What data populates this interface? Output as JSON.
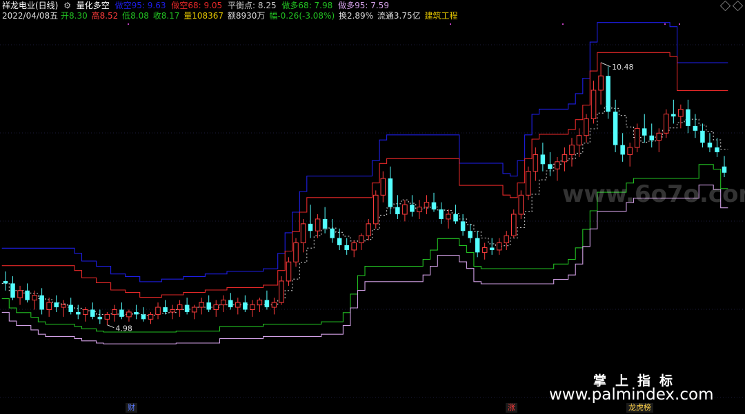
{
  "header": {
    "stock": "祥龙电业(日线)",
    "indicator": "量化多空",
    "lines": [
      {
        "label": "做空95: 9.63",
        "color": "#1e1ee6"
      },
      {
        "label": "做空68: 9.05",
        "color": "#e62828"
      },
      {
        "label": "平衡点: 8.25",
        "color": "#c8c8c8"
      },
      {
        "label": "做多68: 7.98",
        "color": "#22c022"
      },
      {
        "label": "做多95: 7.59",
        "color": "#d2a0e6"
      }
    ]
  },
  "quote": {
    "date": "2022/04/08五",
    "open": "开8.30",
    "high": "高8.52",
    "low": "低8.08",
    "close": "收8.17",
    "volume": "量108367",
    "amount": "额8930万",
    "change": "幅-0.26(-3.08%)",
    "turnover": "换2.89%",
    "float": "流通3.75亿",
    "sector": "建筑工程"
  },
  "chart_data": {
    "type": "candlestick",
    "ylim": [
      3.3,
      11.3
    ],
    "annotations": {
      "max_label": "10.48",
      "min_label": "4.98"
    },
    "series_names": [
      "做空95",
      "做空68",
      "平衡点",
      "做多68",
      "做多95"
    ],
    "candles": [
      [
        5.9,
        6.1,
        5.7,
        5.85
      ],
      [
        5.85,
        6.0,
        5.5,
        5.55
      ],
      [
        5.55,
        5.8,
        5.4,
        5.7
      ],
      [
        5.7,
        5.85,
        5.45,
        5.5
      ],
      [
        5.5,
        5.7,
        5.3,
        5.6
      ],
      [
        5.6,
        5.75,
        5.2,
        5.3
      ],
      [
        5.3,
        5.55,
        5.15,
        5.45
      ],
      [
        5.45,
        5.6,
        5.25,
        5.35
      ],
      [
        5.35,
        5.5,
        5.15,
        5.4
      ],
      [
        5.4,
        5.55,
        5.2,
        5.25
      ],
      [
        5.25,
        5.4,
        5.1,
        5.2
      ],
      [
        5.2,
        5.35,
        5.05,
        5.3
      ],
      [
        5.3,
        5.45,
        5.1,
        5.15
      ],
      [
        5.15,
        5.3,
        5.0,
        5.1
      ],
      [
        5.1,
        5.25,
        4.98,
        5.2
      ],
      [
        5.2,
        5.4,
        5.05,
        5.3
      ],
      [
        5.3,
        5.45,
        5.1,
        5.15
      ],
      [
        5.15,
        5.3,
        5.05,
        5.25
      ],
      [
        5.25,
        5.4,
        5.1,
        5.2
      ],
      [
        5.2,
        5.35,
        5.05,
        5.1
      ],
      [
        5.1,
        5.25,
        5.0,
        5.2
      ],
      [
        5.2,
        5.45,
        5.1,
        5.35
      ],
      [
        5.35,
        5.5,
        5.2,
        5.25
      ],
      [
        5.25,
        5.4,
        5.1,
        5.3
      ],
      [
        5.3,
        5.5,
        5.15,
        5.4
      ],
      [
        5.4,
        5.55,
        5.2,
        5.25
      ],
      [
        5.25,
        5.4,
        5.1,
        5.35
      ],
      [
        5.35,
        5.55,
        5.2,
        5.45
      ],
      [
        5.45,
        5.6,
        5.25,
        5.3
      ],
      [
        5.3,
        5.5,
        5.15,
        5.4
      ],
      [
        5.4,
        5.6,
        5.25,
        5.5
      ],
      [
        5.5,
        5.65,
        5.3,
        5.35
      ],
      [
        5.35,
        5.55,
        5.2,
        5.45
      ],
      [
        5.45,
        5.6,
        5.25,
        5.3
      ],
      [
        5.3,
        5.5,
        5.15,
        5.4
      ],
      [
        5.4,
        5.55,
        5.25,
        5.5
      ],
      [
        5.5,
        5.7,
        5.3,
        5.35
      ],
      [
        5.35,
        5.55,
        5.2,
        5.45
      ],
      [
        5.45,
        6.0,
        5.4,
        5.9
      ],
      [
        5.9,
        6.4,
        5.8,
        6.3
      ],
      [
        6.3,
        6.8,
        6.2,
        6.7
      ],
      [
        6.7,
        7.2,
        6.5,
        7.1
      ],
      [
        7.1,
        7.5,
        6.8,
        6.95
      ],
      [
        6.95,
        7.3,
        6.8,
        7.2
      ],
      [
        7.2,
        7.45,
        6.9,
        7.0
      ],
      [
        7.0,
        7.2,
        6.7,
        6.8
      ],
      [
        6.8,
        7.0,
        6.55,
        6.65
      ],
      [
        6.65,
        6.8,
        6.45,
        6.55
      ],
      [
        6.55,
        6.75,
        6.4,
        6.7
      ],
      [
        6.7,
        6.9,
        6.55,
        6.85
      ],
      [
        6.85,
        7.2,
        6.75,
        7.1
      ],
      [
        7.1,
        7.8,
        7.0,
        7.7
      ],
      [
        7.7,
        8.2,
        7.55,
        8.05
      ],
      [
        8.05,
        8.3,
        7.3,
        7.45
      ],
      [
        7.45,
        7.7,
        7.2,
        7.3
      ],
      [
        7.3,
        7.6,
        7.15,
        7.5
      ],
      [
        7.5,
        7.7,
        7.25,
        7.35
      ],
      [
        7.35,
        7.6,
        7.2,
        7.45
      ],
      [
        7.45,
        7.7,
        7.3,
        7.55
      ],
      [
        7.55,
        7.75,
        7.35,
        7.4
      ],
      [
        7.4,
        7.55,
        7.1,
        7.2
      ],
      [
        7.2,
        7.4,
        7.0,
        7.3
      ],
      [
        7.3,
        7.5,
        7.1,
        7.15
      ],
      [
        7.15,
        7.3,
        6.85,
        6.95
      ],
      [
        6.95,
        7.1,
        6.7,
        6.8
      ],
      [
        6.8,
        6.95,
        6.4,
        6.5
      ],
      [
        6.5,
        6.7,
        6.35,
        6.6
      ],
      [
        6.6,
        6.8,
        6.45,
        6.55
      ],
      [
        6.55,
        6.8,
        6.45,
        6.7
      ],
      [
        6.7,
        6.95,
        6.55,
        6.85
      ],
      [
        6.85,
        7.4,
        6.8,
        7.3
      ],
      [
        7.3,
        7.8,
        7.2,
        7.7
      ],
      [
        7.7,
        8.3,
        7.6,
        8.2
      ],
      [
        8.2,
        8.7,
        8.0,
        8.55
      ],
      [
        8.55,
        8.8,
        8.2,
        8.35
      ],
      [
        8.35,
        8.6,
        8.1,
        8.25
      ],
      [
        8.25,
        8.5,
        8.0,
        8.4
      ],
      [
        8.4,
        8.7,
        8.2,
        8.55
      ],
      [
        8.55,
        8.9,
        8.3,
        8.75
      ],
      [
        8.75,
        9.1,
        8.5,
        8.95
      ],
      [
        8.95,
        9.4,
        8.8,
        9.3
      ],
      [
        9.3,
        10.1,
        9.2,
        9.9
      ],
      [
        9.9,
        10.48,
        9.6,
        10.2
      ],
      [
        10.2,
        10.4,
        9.3,
        9.45
      ],
      [
        9.45,
        9.7,
        8.6,
        8.75
      ],
      [
        8.75,
        9.0,
        8.4,
        8.55
      ],
      [
        8.55,
        8.8,
        8.3,
        8.7
      ],
      [
        8.7,
        9.2,
        8.6,
        9.1
      ],
      [
        9.1,
        9.4,
        8.8,
        8.95
      ],
      [
        8.95,
        9.2,
        8.7,
        8.85
      ],
      [
        8.85,
        9.1,
        8.6,
        9.0
      ],
      [
        9.0,
        9.5,
        8.9,
        9.4
      ],
      [
        9.4,
        9.7,
        9.2,
        9.35
      ],
      [
        9.35,
        9.6,
        9.1,
        9.5
      ],
      [
        9.5,
        9.7,
        9.0,
        9.15
      ],
      [
        9.15,
        9.4,
        8.9,
        9.05
      ],
      [
        9.05,
        9.2,
        8.7,
        8.8
      ],
      [
        8.8,
        9.0,
        8.6,
        8.7
      ],
      [
        8.7,
        8.9,
        8.5,
        8.6
      ],
      [
        8.3,
        8.52,
        8.08,
        8.17
      ]
    ]
  },
  "markers": [
    {
      "text": "财",
      "color": "#5a7aff",
      "bg": "#1a1a1a"
    },
    {
      "text": "涨",
      "color": "#ff3c3c",
      "bg": "#1a1a1a"
    },
    {
      "text": "龙虎榜",
      "color": "#ffd24a",
      "bg": "#1a1a1a"
    }
  ],
  "watermark": {
    "cn": "掌上指标",
    "url": "www.palmindex.com",
    "faint": "www.6o7o.com"
  }
}
